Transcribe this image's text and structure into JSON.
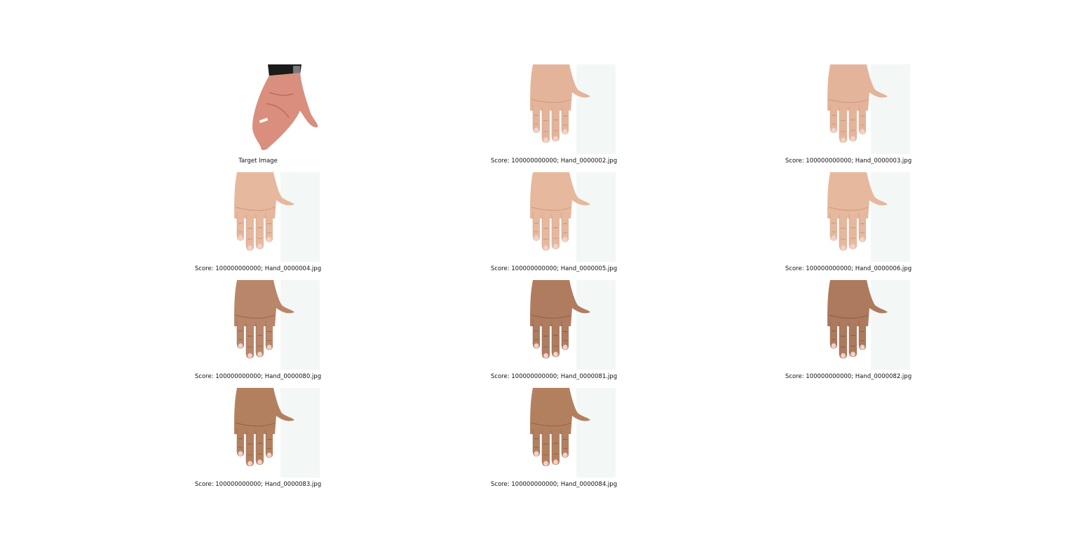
{
  "figure": {
    "panels": [
      {
        "caption": "Target Image",
        "kind": "target",
        "skin": "#d98e7e",
        "skin_shadow": "#b8665a"
      },
      {
        "caption": "Score: 100000000000; Hand_0000002.jpg",
        "kind": "hand",
        "skin": "#e4b49a",
        "skin_shadow": "#c89178"
      },
      {
        "caption": "Score: 100000000000; Hand_0000003.jpg",
        "kind": "hand",
        "skin": "#e4b49a",
        "skin_shadow": "#c89178"
      },
      {
        "caption": "Score: 100000000000; Hand_0000004.jpg",
        "kind": "hand",
        "skin": "#e6b89d",
        "skin_shadow": "#c89178"
      },
      {
        "caption": "Score: 100000000000; Hand_0000005.jpg",
        "kind": "hand",
        "skin": "#e6b89d",
        "skin_shadow": "#c89178"
      },
      {
        "caption": "Score: 100000000000; Hand_0000006.jpg",
        "kind": "hand",
        "skin": "#e6b89d",
        "skin_shadow": "#c89178"
      },
      {
        "caption": "Score: 100000000000; Hand_0000080.jpg",
        "kind": "hand",
        "skin": "#b98669",
        "skin_shadow": "#8f6048"
      },
      {
        "caption": "Score: 100000000000; Hand_0000081.jpg",
        "kind": "hand",
        "skin": "#b07c60",
        "skin_shadow": "#865a43"
      },
      {
        "caption": "Score: 100000000000; Hand_0000082.jpg",
        "kind": "hand",
        "skin": "#ad7a5e",
        "skin_shadow": "#835841"
      },
      {
        "caption": "Score: 100000000000; Hand_0000083.jpg",
        "kind": "hand",
        "skin": "#b3805f",
        "skin_shadow": "#8a5d44"
      },
      {
        "caption": "Score: 100000000000; Hand_0000084.jpg",
        "kind": "hand",
        "skin": "#b3805f",
        "skin_shadow": "#8a5d44"
      }
    ]
  }
}
